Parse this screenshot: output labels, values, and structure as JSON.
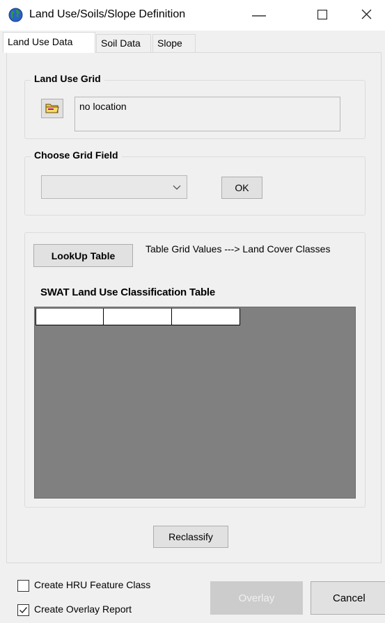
{
  "window": {
    "title": "Land Use/Soils/Slope Definition",
    "controls": {
      "minimize": "—",
      "maximize": "☐",
      "close": "✕"
    },
    "app_icon": "globe-icon"
  },
  "tabs": [
    {
      "label": "Land Use Data",
      "selected": true
    },
    {
      "label": "Soil Data",
      "selected": false
    },
    {
      "label": "Slope",
      "selected": false
    }
  ],
  "land_use_grid": {
    "legend": "Land Use Grid",
    "folder_icon": "folder-icon",
    "location_text": "no location"
  },
  "choose_grid_field": {
    "legend": "Choose Grid Field",
    "selected_value": "",
    "ok_label": "OK"
  },
  "lookup": {
    "button_label": "LookUp Table",
    "description": "Table Grid Values ---> Land Cover Classes",
    "table_title": "SWAT Land Use Classification Table",
    "columns": [
      "",
      "",
      ""
    ]
  },
  "reclassify_label": "Reclassify",
  "options": {
    "create_hru": {
      "label": "Create HRU Feature Class",
      "checked": false
    },
    "create_overlay_report": {
      "label": "Create Overlay Report",
      "checked": true
    }
  },
  "buttons": {
    "overlay": {
      "label": "Overlay",
      "enabled": false
    },
    "cancel": {
      "label": "Cancel"
    }
  },
  "colors": {
    "grid_background": "#808080",
    "disabled_button": "#cccccc"
  }
}
